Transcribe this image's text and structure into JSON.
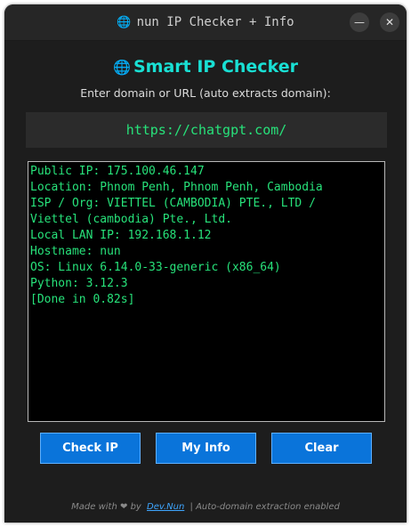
{
  "window": {
    "title": "nun IP Checker + Info",
    "title_icon": "globe-icon",
    "minimize_glyph": "—",
    "close_glyph": "✕"
  },
  "app": {
    "title": "Smart IP Checker",
    "title_icon": "globe-icon",
    "prompt": "Enter domain or URL (auto extracts domain):"
  },
  "input": {
    "value": "https://chatgpt.com/"
  },
  "output": {
    "lines": [
      "Public IP: 175.100.46.147",
      "Location: Phnom Penh, Phnom Penh, Cambodia",
      "ISP / Org: VIETTEL (CAMBODIA) PTE., LTD /",
      "Viettel (cambodia) Pte., Ltd.",
      "Local LAN IP: 192.168.1.12",
      "Hostname: nun",
      "OS: Linux 6.14.0-33-generic (x86_64)",
      "Python: 3.12.3",
      "[Done in 0.82s]"
    ]
  },
  "buttons": {
    "check_ip": "Check IP",
    "my_info": "My Info",
    "clear": "Clear"
  },
  "footer": {
    "made_with": "Made with",
    "heart": "❤",
    "by": "by",
    "author_link": "Dev.Nun",
    "note": "| Auto-domain extraction enabled"
  },
  "colors": {
    "accent_title": "#19e0d4",
    "terminal_text": "#27e27a",
    "button_bg": "#0a74da",
    "link": "#3ea6ff"
  }
}
